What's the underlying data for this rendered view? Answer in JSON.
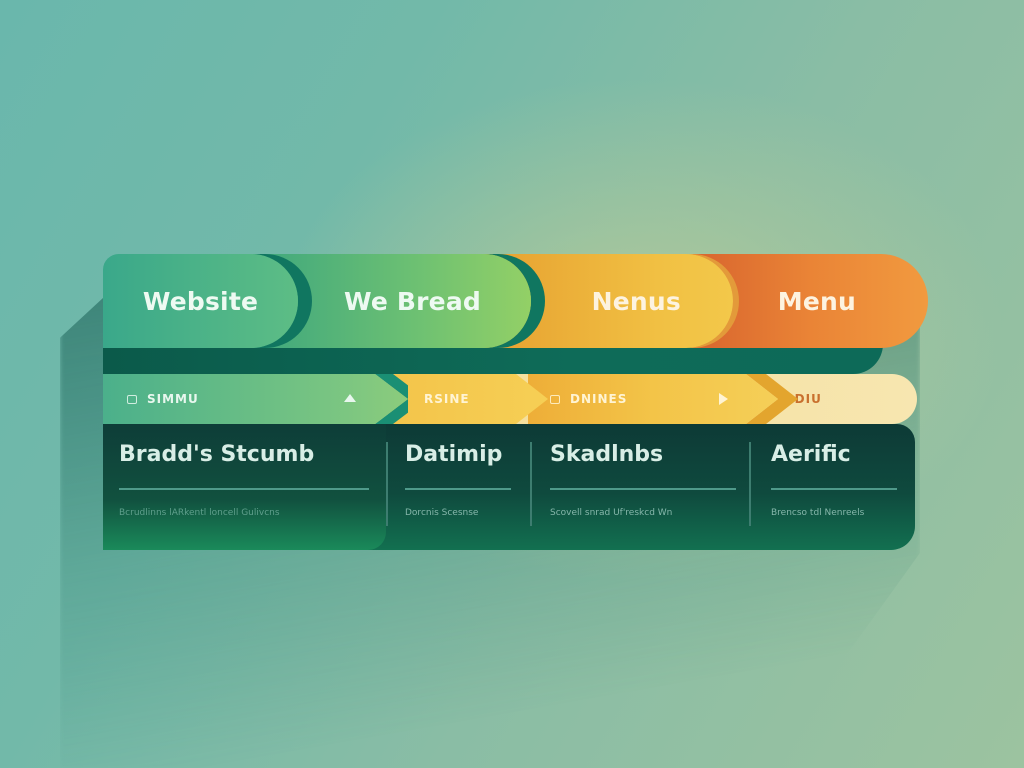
{
  "tabs": [
    {
      "label": "Website"
    },
    {
      "label": "We Bread"
    },
    {
      "label": "Nenus"
    },
    {
      "label": "Menu"
    }
  ],
  "breadcrumbs": [
    {
      "label": "SIMMU",
      "icon": "folder-icon",
      "trailing_icon": "arrow-up-icon"
    },
    {
      "label": "RSINE"
    },
    {
      "label": "DNINES",
      "icon": "folder-icon",
      "trailing_icon": "play-arrow-icon"
    },
    {
      "label": "SDIU"
    }
  ],
  "columns": [
    {
      "title": "Bradd's Stcumb",
      "subtitle": "Bcrudlinns lARkentl loncell Gulivcns"
    },
    {
      "title": "Datimip",
      "subtitle": "Dorcnis Scesnse"
    },
    {
      "title": "Skadlnbs",
      "subtitle": "Scovell snrad Uf'reskcd Wn"
    },
    {
      "title": "Aerific",
      "subtitle": "Brencso tdl Nenreels"
    }
  ],
  "colors": {
    "tab_green": "#3aa88a",
    "tab_lime": "#93d066",
    "tab_yellow": "#f1c043",
    "tab_orange": "#ea8436",
    "panel_dark": "#0d3a36",
    "background": "#8abda5"
  }
}
